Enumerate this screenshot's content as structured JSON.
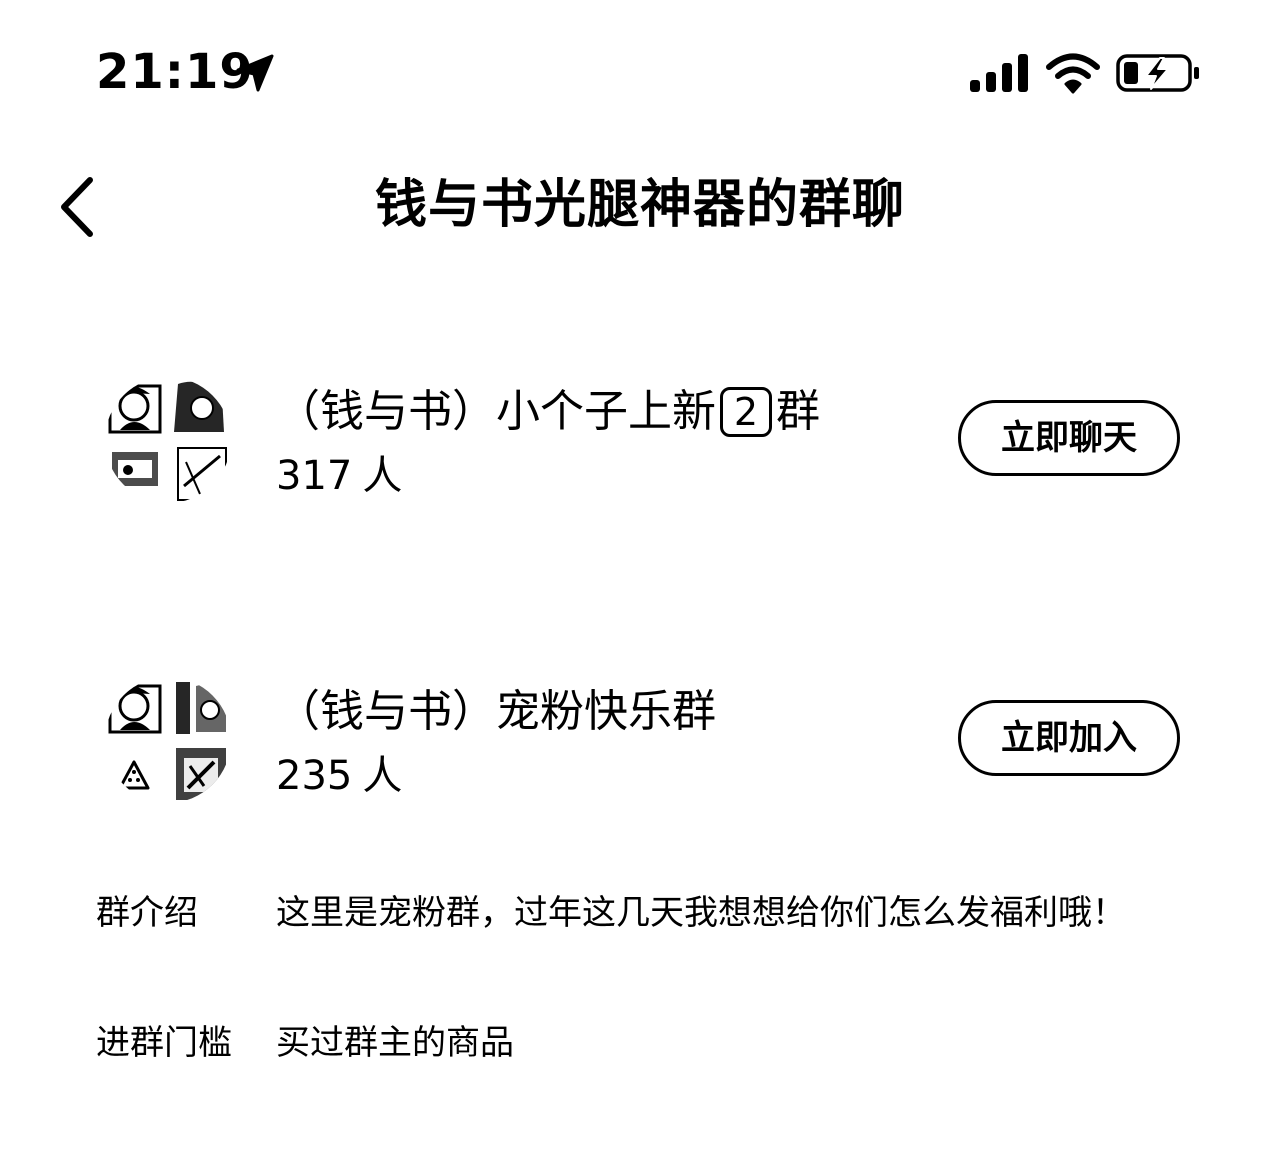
{
  "status_bar": {
    "time": "21:19",
    "icons": [
      "location-arrow-icon",
      "cellular-signal-icon",
      "wifi-icon",
      "battery-charging-icon"
    ]
  },
  "nav": {
    "back_icon": "chevron-left-icon",
    "title": "钱与书光腿神器的群聊"
  },
  "groups": [
    {
      "name": "（钱与书）小个子上新",
      "badge": "2",
      "name_suffix": "群",
      "count": "317",
      "count_unit": "人",
      "action_label": "立即聊天"
    },
    {
      "name": "（钱与书）宠粉快乐群",
      "count": "235",
      "count_unit": "人",
      "action_label": "立即加入"
    }
  ],
  "intro": {
    "label": "群介绍",
    "value": "这里是宠粉群，过年这几天我想想给你们怎么发福利哦！"
  },
  "threshold": {
    "label": "进群门槛",
    "value": "买过群主的商品"
  },
  "colors": {
    "text": "#000000",
    "background": "#ffffff"
  }
}
